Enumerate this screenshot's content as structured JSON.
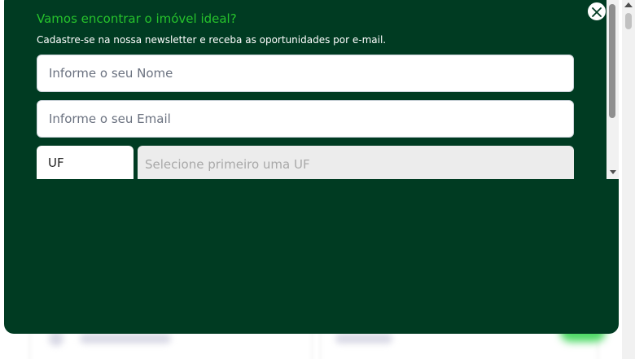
{
  "modal": {
    "title": "Vamos encontrar o imóvel ideal?",
    "subtitle": "Cadastre-se na nossa newsletter e receba as oportunidades por e-mail.",
    "name_placeholder": "Informe o seu Nome",
    "email_placeholder": "Informe o seu Email",
    "uf_value": "UF",
    "city_placeholder": "Selecione primeiro uma UF",
    "close_icon": "close-icon"
  },
  "colors": {
    "modal_background": "#003b22",
    "title_accent": "#26c22c"
  }
}
